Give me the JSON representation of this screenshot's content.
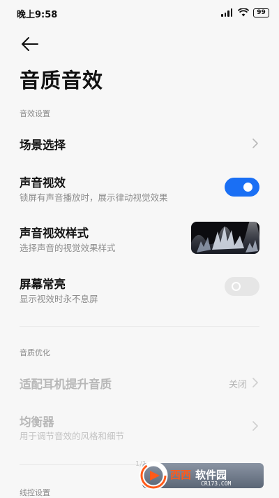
{
  "status_bar": {
    "time": "晚上9:58",
    "battery": "99"
  },
  "header": {
    "back_icon": "arrow-left-icon",
    "title": "音质音效"
  },
  "sections": {
    "effects": {
      "header": "音效设置",
      "scene": {
        "title": "场景选择",
        "icon": "chevron-right-icon"
      },
      "sound_visual": {
        "title": "声音视效",
        "subtitle": "锁屏有声音播放时，展示律动视觉效果",
        "enabled": true
      },
      "sound_visual_style": {
        "title": "声音视效样式",
        "subtitle": "选择声音的视觉效果样式"
      },
      "screen_on": {
        "title": "屏幕常亮",
        "subtitle": "显示视效时永不息屏",
        "enabled": false
      }
    },
    "quality": {
      "header": "音质优化",
      "headphone": {
        "title": "适配耳机提升音质",
        "value": "关闭",
        "icon": "chevron-right-icon"
      },
      "equalizer": {
        "title": "均衡器",
        "subtitle": "用于调节音效的风格和细节",
        "icon": "chevron-right-icon"
      }
    },
    "wire_control": {
      "header": "线控设置"
    }
  },
  "watermark": {
    "brand": "西西",
    "name": "软件园",
    "url": "CR173.COM",
    "faint": "1/1"
  },
  "colors": {
    "accent": "#1a6ff4",
    "background": "#f7f7f7"
  }
}
